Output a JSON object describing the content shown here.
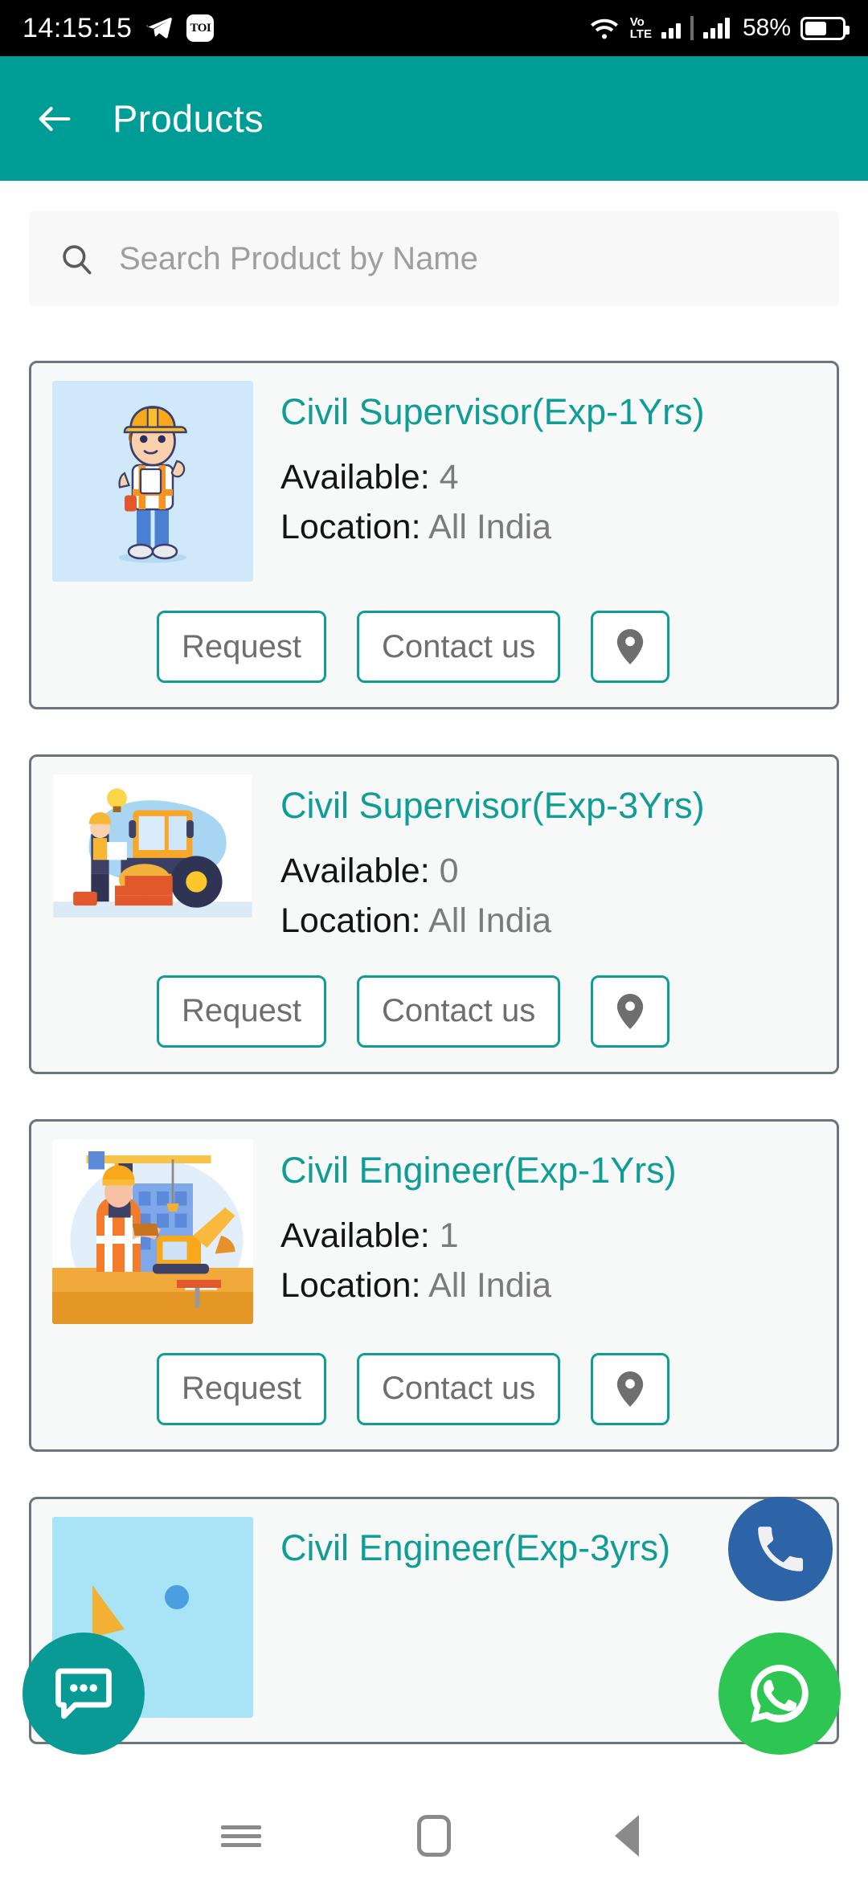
{
  "status_bar": {
    "time": "14:15:15",
    "notification_icons": [
      "telegram-icon",
      "toi-icon"
    ],
    "toi_label": "TOI",
    "network_label_top": "Vo",
    "network_label_bottom": "LTE",
    "battery_percent": "58%"
  },
  "app_bar": {
    "back_label": "back-arrow",
    "title": "Products"
  },
  "search": {
    "placeholder": "Search Product by Name",
    "value": ""
  },
  "buttons": {
    "request": "Request",
    "contact_us": "Contact us",
    "location_icon": "map-pin-icon"
  },
  "labels": {
    "available": "Available:",
    "location": "Location:"
  },
  "products": [
    {
      "title": "Civil Supervisor(Exp-1Yrs)",
      "available": "4",
      "location": "All India",
      "image": "construction-supervisor-thumbs-up"
    },
    {
      "title": "Civil Supervisor(Exp-3Yrs)",
      "available": "0",
      "location": "All India",
      "image": "road-roller-worker"
    },
    {
      "title": "Civil Engineer(Exp-1Yrs)",
      "available": "1",
      "location": "All India",
      "image": "engineer-crane-excavator"
    },
    {
      "title": "Civil Engineer(Exp-3yrs)",
      "available": "",
      "location": "",
      "image": "partially-visible-thumbnail"
    }
  ],
  "fabs": {
    "call": "call-icon",
    "chat": "chat-icon",
    "whatsapp": "whatsapp-icon"
  },
  "nav_bar": {
    "recents": "recents-button",
    "home": "home-button",
    "back": "back-button"
  },
  "colors": {
    "teal": "#009c96",
    "title_teal": "#0f9d96",
    "call_blue": "#2d64a8",
    "whatsapp_green": "#2dc653",
    "card_border": "#6d737d"
  }
}
